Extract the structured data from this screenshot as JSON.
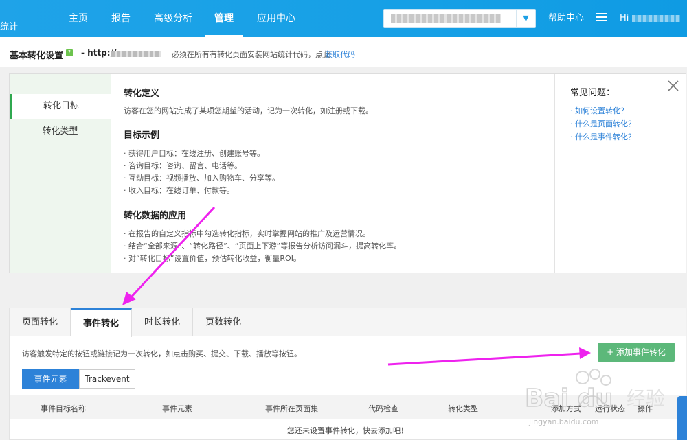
{
  "brand": "统计",
  "nav": {
    "items": [
      "主页",
      "报告",
      "高级分析",
      "管理",
      "应用中心"
    ],
    "active": "管理",
    "help": "帮助中心",
    "hi": "Hi"
  },
  "settings": {
    "title": "基本转化设置",
    "q_badge": "?",
    "url_prefix": "- http://",
    "install_hint": "必须在所有有转化页面安装网站统计代码，点此",
    "get_code": "获取代码"
  },
  "side_menu": [
    "转化目标",
    "转化类型"
  ],
  "info": {
    "def_title": "转化定义",
    "def_text": "访客在您的网站完成了某项您期望的活动，记为一次转化，如注册或下载。",
    "examples_title": "目标示例",
    "examples": [
      "· 获得用户目标：在线注册、创建账号等。",
      "· 咨询目标：咨询、留言、电话等。",
      "· 互动目标：视频播放、加入购物车、分享等。",
      "· 收入目标：在线订单、付款等。"
    ],
    "apply_title": "转化数据的应用",
    "apply": [
      "· 在报告的自定义指标中勾选转化指标，实时掌握网站的推广及运营情况。",
      "· 结合“全部来源”、“转化路径”、“页面上下游”等报告分析访问漏斗，提高转化率。",
      "· 对“转化目标”设置价值，预估转化收益，衡量ROI。"
    ]
  },
  "faq": {
    "title": "常见问题：",
    "links": [
      "· 如何设置转化？",
      "· 什么是页面转化？",
      "· 什么是事件转化？"
    ]
  },
  "tabs": [
    "页面转化",
    "事件转化",
    "时长转化",
    "页数转化"
  ],
  "active_tab": "事件转化",
  "event": {
    "hint": "访客触发特定的按钮或链接记为一次转化，如点击购买、提交、下载、播放等按钮。",
    "add_button": "+ 添加事件转化",
    "seg_options": [
      "事件元素",
      "Trackevent"
    ],
    "columns": [
      "事件目标名称",
      "事件元素",
      "事件所在页面集",
      "代码检查",
      "转化类型",
      "添加方式",
      "运行状态",
      "操作"
    ],
    "empty": "您还未设置事件转化，快去添加吧！"
  },
  "watermark": "jingyan.baidu.com",
  "colors": {
    "nav": "#16a0e6",
    "accent": "#2d82d8",
    "green": "#5cb87a",
    "annotation": "#ee22ee"
  }
}
